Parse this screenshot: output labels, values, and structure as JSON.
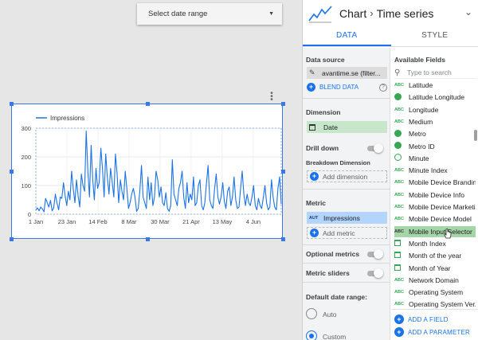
{
  "canvas": {
    "date_range_label": "Select date range"
  },
  "chart_data": {
    "type": "line",
    "title": "",
    "xlabel": "",
    "ylabel": "",
    "legend_position": "top-left",
    "ylim": [
      0,
      300
    ],
    "y_ticks": [
      "0",
      "100",
      "200",
      "300"
    ],
    "x_ticks": [
      "1 Jan",
      "23 Jan",
      "14 Feb",
      "8 Mar",
      "30 Mar",
      "21 Apr",
      "13 May",
      "4 Jun"
    ],
    "grid": true,
    "series": [
      {
        "name": "Impressions",
        "color": "#1a73e8",
        "values": [
          15,
          22,
          12,
          25,
          18,
          8,
          55,
          40,
          25,
          48,
          12,
          22,
          70,
          40,
          15,
          60,
          55,
          110,
          65,
          30,
          80,
          50,
          150,
          90,
          40,
          120,
          65,
          25,
          140,
          100,
          80,
          290,
          150,
          60,
          240,
          120,
          50,
          160,
          90,
          110,
          230,
          160,
          60,
          210,
          130,
          70,
          160,
          110,
          60,
          210,
          140,
          40,
          120,
          80,
          50,
          150,
          90,
          20,
          40,
          70,
          90,
          60,
          10,
          20,
          80,
          170,
          60,
          40,
          20,
          130,
          50,
          110,
          30,
          60,
          150,
          120,
          60,
          95,
          40,
          30,
          75,
          20,
          10,
          30,
          190,
          70,
          50,
          30,
          90,
          110,
          150,
          60,
          20,
          110,
          40,
          70,
          50,
          130,
          30,
          40,
          100,
          120,
          30,
          15,
          40,
          110,
          170,
          50,
          30,
          20,
          90,
          140,
          60,
          35,
          60,
          110,
          45,
          20,
          80,
          95,
          30,
          60,
          130,
          50,
          20,
          25,
          90,
          150,
          70,
          30,
          70,
          40,
          30,
          60,
          100,
          30,
          15,
          55,
          30,
          20,
          60,
          100,
          40,
          15,
          25,
          120,
          60,
          25,
          15,
          90,
          130,
          35
        ]
      }
    ]
  },
  "panel": {
    "chart_label": "Chart",
    "chart_type": "Time series",
    "tabs": [
      "DATA",
      "STYLE"
    ],
    "data_source_title": "Data source",
    "data_source_value": "avantime.se (filter...",
    "blend_label": "BLEND DATA",
    "dimension_title": "Dimension",
    "dimension_value": "Date",
    "drill_down_label": "Drill down",
    "breakdown_title": "Breakdown Dimension",
    "add_dimension_label": "Add dimension",
    "metric_title": "Metric",
    "metric_badge": "AUT",
    "metric_value": "Impressions",
    "add_metric_label": "Add metric",
    "optional_metrics_label": "Optional metrics",
    "metric_sliders_label": "Metric sliders",
    "default_date_title": "Default date range:",
    "radio_auto": "Auto",
    "radio_custom": "Custom",
    "available_fields_title": "Available Fields",
    "search_placeholder": "Type to search",
    "fields": [
      {
        "type": "ABC",
        "label": "Latitude"
      },
      {
        "type": "geo",
        "label": "Latitude Longitude"
      },
      {
        "type": "ABC",
        "label": "Longitude"
      },
      {
        "type": "ABC",
        "label": "Medium"
      },
      {
        "type": "geo",
        "label": "Metro"
      },
      {
        "type": "geo",
        "label": "Metro ID"
      },
      {
        "type": "time",
        "label": "Minute"
      },
      {
        "type": "ABC",
        "label": "Minute Index"
      },
      {
        "type": "ABC",
        "label": "Mobile Device Branding"
      },
      {
        "type": "ABC",
        "label": "Mobile Device Info"
      },
      {
        "type": "ABC",
        "label": "Mobile Device Marketi..."
      },
      {
        "type": "ABC",
        "label": "Mobile Device Model"
      },
      {
        "type": "ABC",
        "label": "Mobile Input Selector",
        "highlight": true
      },
      {
        "type": "cal",
        "label": "Month Index"
      },
      {
        "type": "cal",
        "label": "Month of the year"
      },
      {
        "type": "cal",
        "label": "Month of Year"
      },
      {
        "type": "ABC",
        "label": "Network Domain"
      },
      {
        "type": "ABC",
        "label": "Operating System"
      },
      {
        "type": "ABC",
        "label": "Operating System Ver..."
      }
    ],
    "add_field_label": "ADD A FIELD",
    "add_parameter_label": "ADD A PARAMETER"
  }
}
